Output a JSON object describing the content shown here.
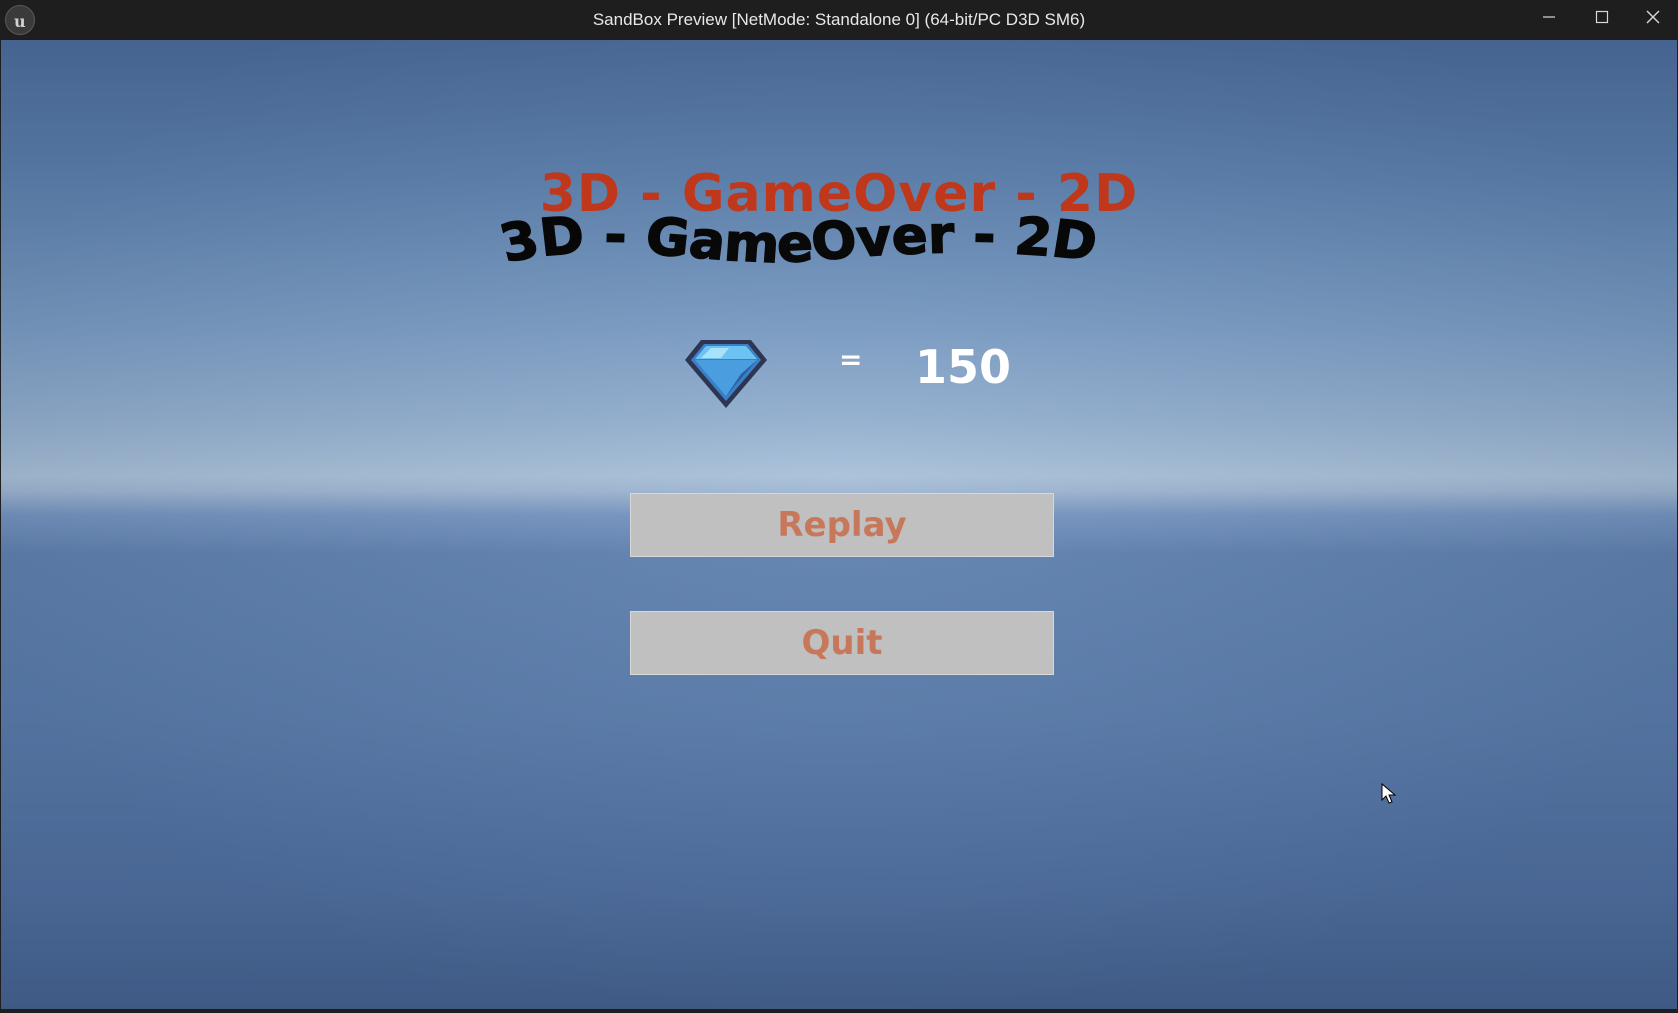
{
  "window": {
    "title": "SandBox Preview [NetMode: Standalone 0]  (64-bit/PC D3D SM6)",
    "controls": {
      "minimize_icon": "minimize-icon",
      "maximize_icon": "maximize-icon",
      "close_icon": "close-icon"
    },
    "app_icon": "unreal-engine-logo"
  },
  "game_over": {
    "title_front": "3D - GameOver - 2D",
    "title_3d": "3D - GameOver - 2D",
    "title_color": "#c0381c",
    "gem_icon": "blue-gem-icon",
    "equals": "=",
    "score": "150",
    "replay_label": "Replay",
    "quit_label": "Quit",
    "button_text_color": "#c8785a",
    "button_bg_color": "#c0c0c0"
  }
}
